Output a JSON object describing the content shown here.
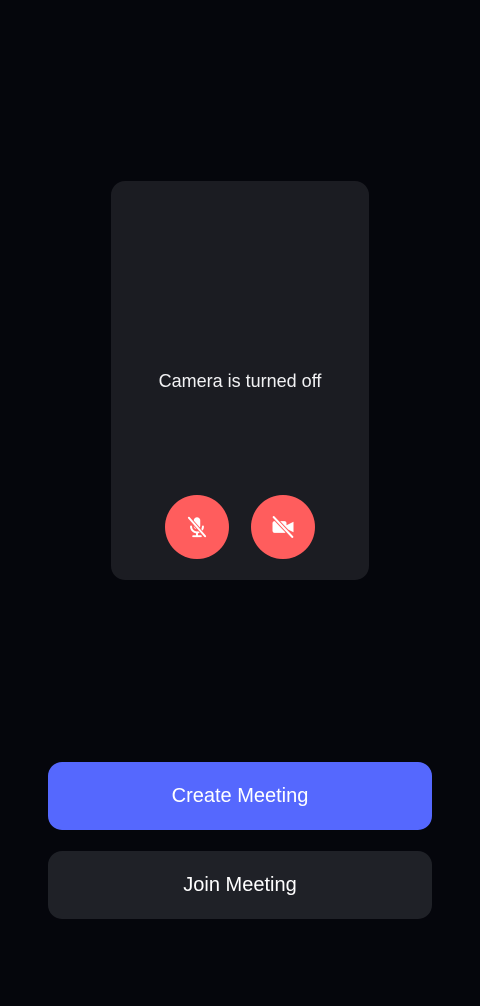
{
  "preview": {
    "status_text": "Camera is turned off"
  },
  "controls": {
    "mic_icon": "mic-off-icon",
    "camera_icon": "video-off-icon",
    "button_color": "#ff5d5d"
  },
  "actions": {
    "create_label": "Create Meeting",
    "join_label": "Join Meeting",
    "create_color": "#5568fe",
    "join_color": "#1f2127"
  }
}
